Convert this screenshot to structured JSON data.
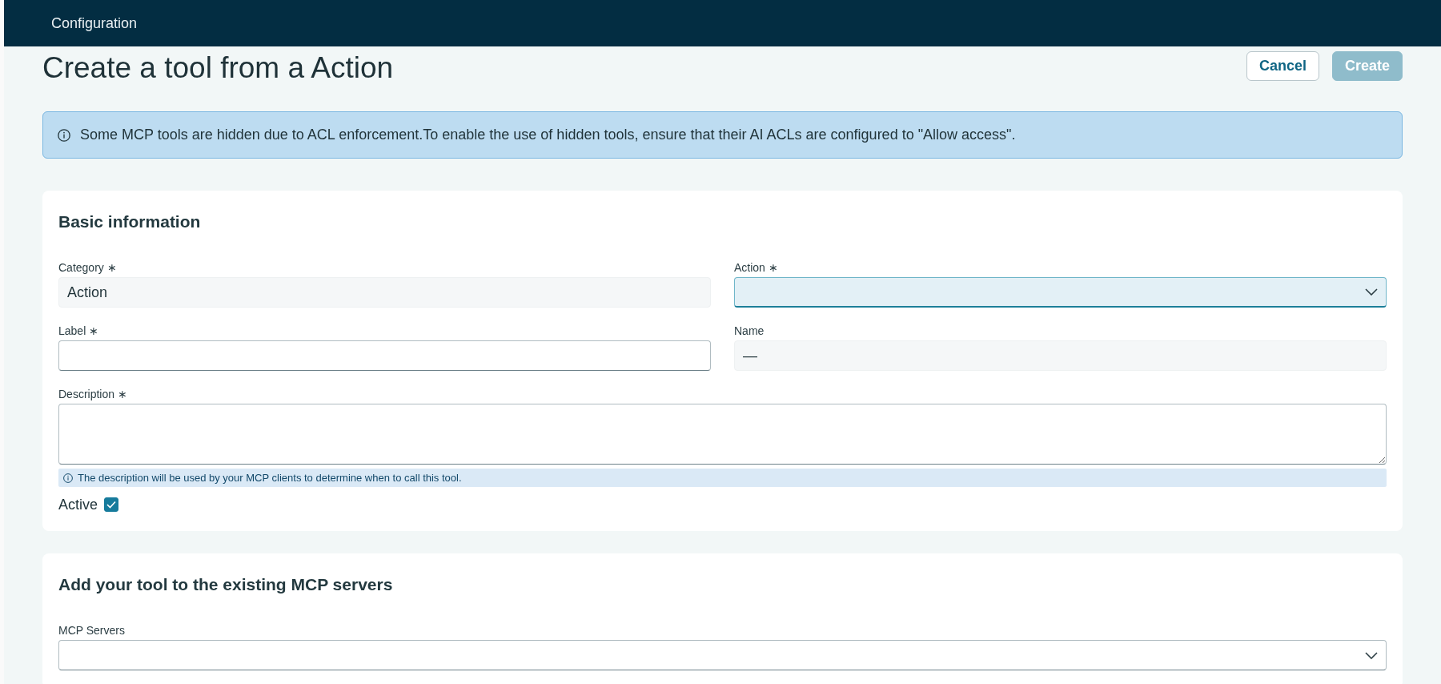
{
  "header": {
    "title": "Configuration"
  },
  "page": {
    "title": "Create a tool from a Action",
    "buttons": [
      {
        "label": "Cancel",
        "kind": "secondary",
        "disabled": false
      },
      {
        "label": "Create",
        "kind": "primary",
        "disabled": true
      }
    ]
  },
  "alert": {
    "text": "Some MCP tools are hidden due to ACL enforcement.To enable the use of hidden tools, ensure that their AI ACLs are configured to \"Allow access\"."
  },
  "sections": [
    {
      "title": "Basic information",
      "rows": [
        {
          "fields": [
            {
              "kind": "readonly",
              "label": "Category ∗",
              "value": "Action"
            },
            {
              "kind": "select",
              "label": "Action ∗",
              "focused": true
            }
          ]
        },
        {
          "fields": [
            {
              "kind": "input",
              "label": "Label ∗",
              "focused": false
            },
            {
              "kind": "readonly",
              "label": "Name",
              "value": "—"
            }
          ]
        },
        {
          "fields": [
            {
              "kind": "textarea",
              "label": "Description ∗",
              "focused": false,
              "help": "The description will be used by your MCP clients to determine when to call this tool."
            }
          ]
        },
        {
          "fields": [
            {
              "kind": "checkbox",
              "label": "Active",
              "checked": true
            }
          ]
        }
      ]
    },
    {
      "title": "Add your tool to the existing MCP servers",
      "rows": [
        {
          "fields": [
            {
              "kind": "select",
              "label": "MCP Servers",
              "focused": false
            }
          ]
        }
      ]
    }
  ]
}
